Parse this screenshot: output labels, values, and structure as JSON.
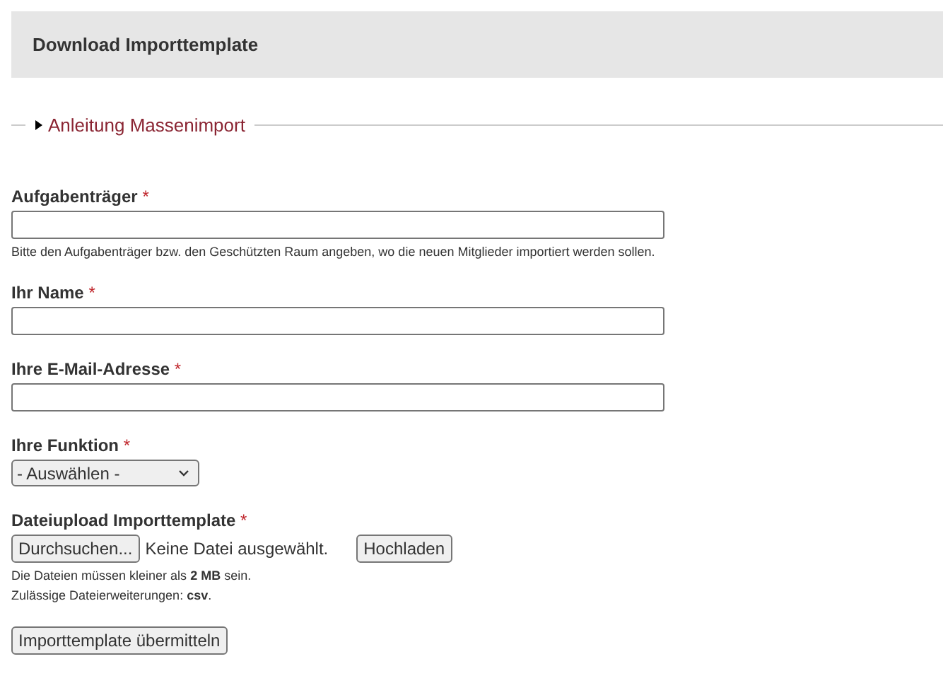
{
  "header": {
    "title": "Download Importtemplate"
  },
  "instructions": {
    "label": "Anleitung Massenimport",
    "expanded": false
  },
  "fields": [
    {
      "kind": "text",
      "label": "Aufgabenträger",
      "required_mark": "*",
      "descriptions": [
        "Bitte den Aufgabenträger bzw. den Geschützten Raum angeben, wo die neuen Mitglieder importiert werden sollen."
      ]
    },
    {
      "kind": "text",
      "label": "Ihr Name",
      "required_mark": "*"
    },
    {
      "kind": "text",
      "label": "Ihre E-Mail-Adresse",
      "required_mark": "*"
    },
    {
      "kind": "select",
      "label": "Ihre Funktion",
      "required_mark": "*",
      "value": "- Auswählen -"
    },
    {
      "kind": "file",
      "label": "Dateiupload Importtemplate",
      "required_mark": "*",
      "browse_button": "Durchsuchen...",
      "file_status": "Keine Datei ausgewählt.",
      "upload_button": "Hochladen",
      "descriptions": [
        "Die Dateien müssen kleiner als **2 MB** sein.",
        "Zulässige Dateierweiterungen: **csv**."
      ]
    }
  ],
  "submit_button": "Importtemplate übermitteln"
}
